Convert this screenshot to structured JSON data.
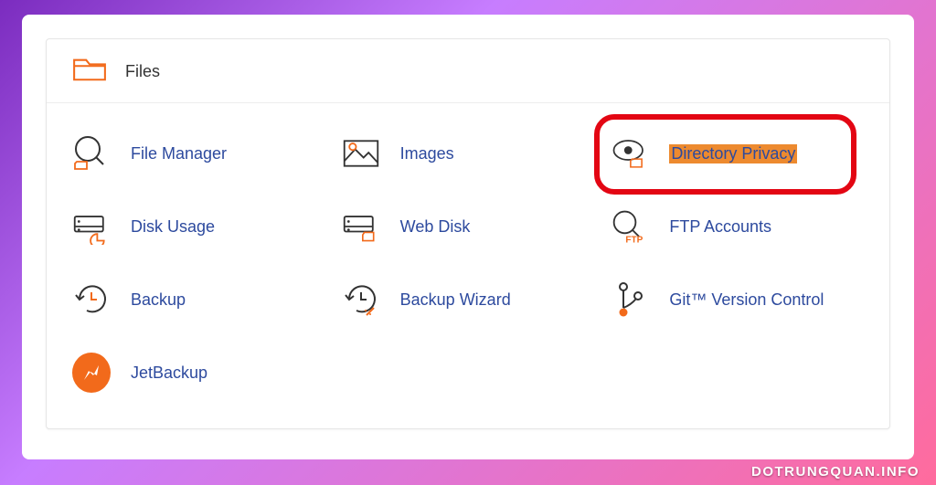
{
  "panel": {
    "title": "Files"
  },
  "items": {
    "file_manager": {
      "label": "File Manager"
    },
    "images": {
      "label": "Images"
    },
    "directory_privacy": {
      "label": "Directory Privacy"
    },
    "disk_usage": {
      "label": "Disk Usage"
    },
    "web_disk": {
      "label": "Web Disk"
    },
    "ftp_accounts": {
      "label": "FTP Accounts"
    },
    "backup": {
      "label": "Backup"
    },
    "backup_wizard": {
      "label": "Backup Wizard"
    },
    "git_version_control": {
      "label": "Git™ Version Control"
    },
    "jetbackup": {
      "label": "JetBackup"
    }
  },
  "watermark": "DOTRUNGQUAN.INFO"
}
